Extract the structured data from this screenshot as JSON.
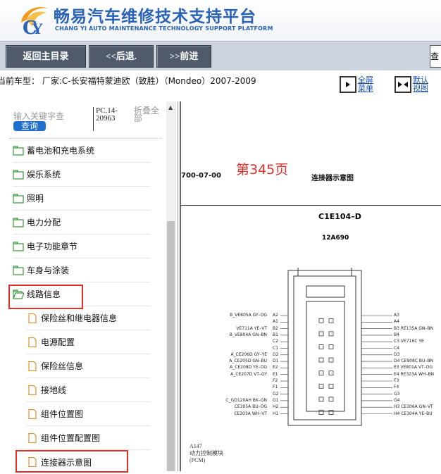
{
  "header": {
    "title": "畅易汽车维修技术支持平台",
    "subtitle": "CHANG YI AUTO MAINTENANCE TECHNOLOGY SUPPORT PLATFORM"
  },
  "toolbar": {
    "back_main": "返回主目录",
    "prev": "<<后退.",
    "next": ">>前进",
    "query": "查"
  },
  "infobar": {
    "vehicle": "当前车型： 厂家:C-长安福特蒙迪欧（致胜）（Mondeo）2007-2009",
    "fullscreen_line1": "全屏",
    "fullscreen_line2": "菜单",
    "default_line1": "默认",
    "default_line2": "视图"
  },
  "search": {
    "placeholder": "输入关键字查",
    "button": "查询",
    "pc_code": "PC.14-20963",
    "collapse_all": "折叠全部"
  },
  "tree": {
    "folders": [
      "蓄电池和充电系统",
      "娱乐系统",
      "照明",
      "电力分配",
      "电子功能章节",
      "车身与涂装",
      "线路信息"
    ],
    "docs": [
      "保险丝和继电器信息",
      "电源配置",
      "保险丝信息",
      "接地线",
      "组件位置图",
      "组件位置配置图",
      "连接器示意图"
    ]
  },
  "doc": {
    "page_number": "第345页",
    "date": "700-07-00",
    "title": "连接器示意图",
    "connector_id": "C1E104–D",
    "part_number": "12A690",
    "note_id": "A147",
    "note_name": "动力控制模块",
    "note_abbr": "(PCM)",
    "pins_left": [
      {
        "wire": "B_VE805A GY–OG",
        "pin": "A2"
      },
      {
        "wire": "",
        "pin": "A1"
      },
      {
        "wire": "VE711A YE–VT",
        "pin": "B2"
      },
      {
        "wire": "B_VE804A GN–BN",
        "pin": "B1"
      },
      {
        "wire": "",
        "pin": "C2"
      },
      {
        "wire": "",
        "pin": "C1"
      },
      {
        "wire": "A_CE206D GY–YE",
        "pin": "D2"
      },
      {
        "wire": "A_CE205D GN–BU",
        "pin": "D1"
      },
      {
        "wire": "A_CE208D YE–OG",
        "pin": "E2"
      },
      {
        "wire": "A_CE207D VT–GY",
        "pin": "E1"
      },
      {
        "wire": "",
        "pin": "F2"
      },
      {
        "wire": "",
        "pin": "F1"
      },
      {
        "wire": "",
        "pin": "G2"
      },
      {
        "wire": "C_GD120AH BK–GN",
        "pin": "G1"
      },
      {
        "wire": "CE305A BU–OG",
        "pin": "H2"
      },
      {
        "wire": "CE303A WH–VT",
        "pin": "H1"
      }
    ],
    "pins_right": [
      {
        "pin": "A3",
        "wire": ""
      },
      {
        "pin": "A4",
        "wire": ""
      },
      {
        "pin": "B3",
        "wire": "RE135A GN–BN"
      },
      {
        "pin": "B4",
        "wire": ""
      },
      {
        "pin": "C3",
        "wire": "VE716C YE"
      },
      {
        "pin": "C4",
        "wire": ""
      },
      {
        "pin": "D3",
        "wire": ""
      },
      {
        "pin": "D4",
        "wire": "CE908C BU–BN"
      },
      {
        "pin": "E3",
        "wire": "VE801A  VT–OG"
      },
      {
        "pin": "E4",
        "wire": "RE323A WH–BN"
      },
      {
        "pin": "F3",
        "wire": ""
      },
      {
        "pin": "F4",
        "wire": ""
      },
      {
        "pin": "G3",
        "wire": ""
      },
      {
        "pin": "G4",
        "wire": ""
      },
      {
        "pin": "H3",
        "wire": "CE306A GN–VT"
      },
      {
        "pin": "H4",
        "wire": "CE304A YE–BU"
      }
    ]
  },
  "colors": {
    "brand_blue": "#2a62b8",
    "highlight_red": "#e0302a",
    "search_blue": "#1e6fd0"
  }
}
